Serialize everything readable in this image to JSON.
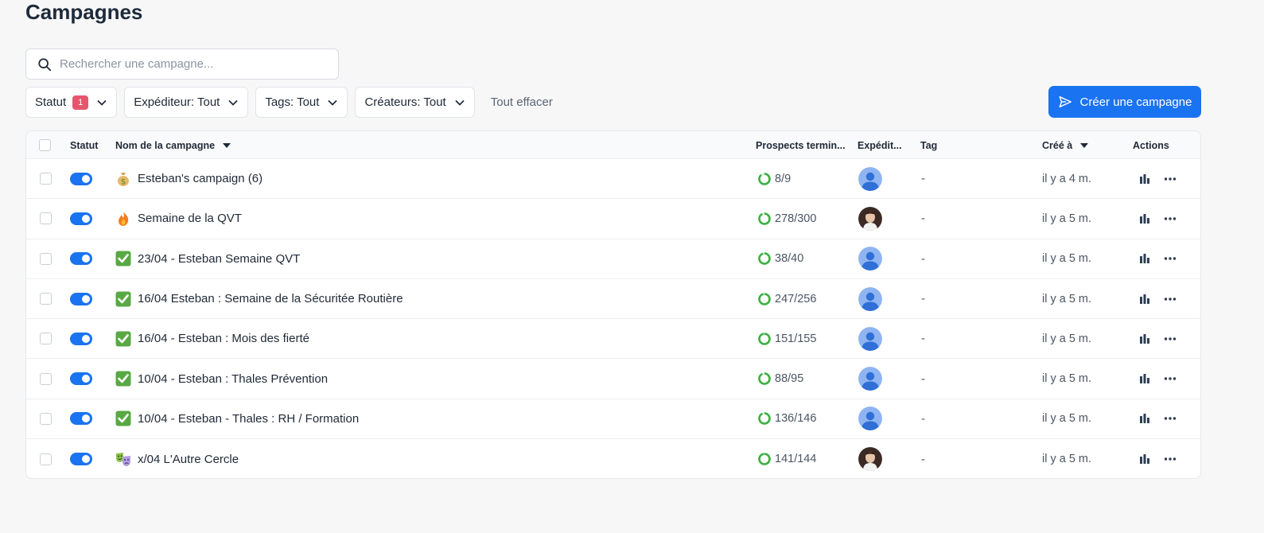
{
  "page": {
    "title": "Campagnes"
  },
  "search": {
    "placeholder": "Rechercher une campagne..."
  },
  "filters": {
    "status_label": "Statut",
    "status_count": "1",
    "sender_label": "Expéditeur: Tout",
    "tags_label": "Tags: Tout",
    "creators_label": "Créateurs: Tout",
    "clear_label": "Tout effacer"
  },
  "create_button": {
    "label": "Créer une campagne"
  },
  "table": {
    "headers": {
      "status": "Statut",
      "name": "Nom de la campagne",
      "prospects": "Prospects termin...",
      "sender": "Expédit...",
      "tag": "Tag",
      "created": "Créé à",
      "actions": "Actions"
    },
    "rows": [
      {
        "emoji": "money-bag-icon",
        "name": "Esteban's campaign (6)",
        "progress": "8/9",
        "done": 8,
        "total": 9,
        "sender": "default-avatar",
        "tag": "-",
        "created": "il y a 4 m.",
        "active": true
      },
      {
        "emoji": "fire-icon",
        "name": "Semaine de la QVT",
        "progress": "278/300",
        "done": 278,
        "total": 300,
        "sender": "photo-avatar",
        "tag": "-",
        "created": "il y a 5 m.",
        "active": true
      },
      {
        "emoji": "check-mark-icon",
        "name": "23/04 - Esteban Semaine QVT",
        "progress": "38/40",
        "done": 38,
        "total": 40,
        "sender": "default-avatar",
        "tag": "-",
        "created": "il y a 5 m.",
        "active": true
      },
      {
        "emoji": "check-mark-icon",
        "name": "16/04 Esteban : Semaine de la Sécuritée Routière",
        "progress": "247/256",
        "done": 247,
        "total": 256,
        "sender": "default-avatar",
        "tag": "-",
        "created": "il y a 5 m.",
        "active": true
      },
      {
        "emoji": "check-mark-icon",
        "name": "16/04 - Esteban : Mois des fierté",
        "progress": "151/155",
        "done": 151,
        "total": 155,
        "sender": "default-avatar",
        "tag": "-",
        "created": "il y a 5 m.",
        "active": true
      },
      {
        "emoji": "check-mark-icon",
        "name": "10/04 - Esteban : Thales Prévention",
        "progress": "88/95",
        "done": 88,
        "total": 95,
        "sender": "default-avatar",
        "tag": "-",
        "created": "il y a 5 m.",
        "active": true
      },
      {
        "emoji": "check-mark-icon",
        "name": "10/04 - Esteban - Thales : RH / Formation",
        "progress": "136/146",
        "done": 136,
        "total": 146,
        "sender": "default-avatar",
        "tag": "-",
        "created": "il y a 5 m.",
        "active": true
      },
      {
        "emoji": "theater-masks-icon",
        "name": "x/04 L'Autre Cercle",
        "progress": "141/144",
        "done": 141,
        "total": 144,
        "sender": "photo-avatar",
        "tag": "-",
        "created": "il y a 5 m.",
        "active": true
      }
    ]
  },
  "colors": {
    "accent": "#1a73f0",
    "badge": "#e5566e",
    "progress": "#3cb043"
  }
}
